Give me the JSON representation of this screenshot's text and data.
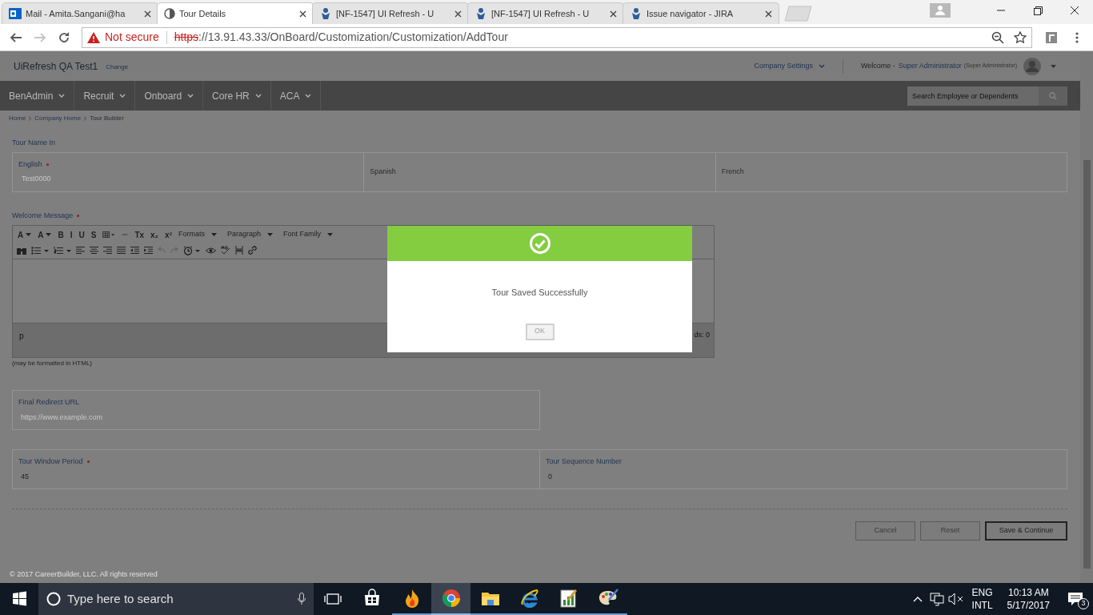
{
  "browser": {
    "tabs": [
      {
        "label": "Mail - Amita.Sangani@ha",
        "kind": "mail",
        "selected": false
      },
      {
        "label": "Tour Details",
        "kind": "page",
        "selected": true
      },
      {
        "label": "[NF-1547] UI Refresh - U",
        "kind": "jira",
        "selected": false
      },
      {
        "label": "[NF-1547] UI Refresh - U",
        "kind": "jira",
        "selected": false
      },
      {
        "label": "Issue navigator - JIRA",
        "kind": "jira",
        "selected": false
      }
    ],
    "security": "Not secure",
    "scheme": "https",
    "url": "://13.91.43.33/OnBoard/Customization/Customization/AddTour"
  },
  "header": {
    "title": "UiRefresh QA Test1",
    "change_link": "Change",
    "company_settings": "Company Settings",
    "welcome": "Welcome -",
    "user": "Super Administrator",
    "role": "(Super Administrator)"
  },
  "nav": {
    "items": [
      "BenAdmin",
      "Recruit",
      "Onboard",
      "Core HR",
      "ACA"
    ],
    "search_placeholder": "Search Employee or Dependents"
  },
  "breadcrumb": [
    "Home",
    "Company Home",
    "Tour Builder"
  ],
  "tour_name": {
    "label": "Tour Name In",
    "fields": [
      {
        "label": "English",
        "required": true,
        "placeholder": "Test0000"
      },
      {
        "label": "Spanish",
        "required": false
      },
      {
        "label": "French",
        "required": false
      }
    ]
  },
  "welcome_message": {
    "label": "Welcome Message",
    "required": true,
    "toolbar_row_1": [
      {
        "kind": "text",
        "text": "A"
      },
      {
        "kind": "text",
        "text": "A"
      },
      {
        "kind": "text",
        "text": "B"
      },
      {
        "kind": "text",
        "text": "I"
      },
      {
        "kind": "text",
        "text": "U"
      },
      {
        "kind": "text",
        "text": "S"
      },
      {
        "kind": "icon"
      },
      {
        "kind": "icon"
      },
      {
        "kind": "text",
        "text": "Tx"
      },
      {
        "kind": "text",
        "text": "x₂"
      },
      {
        "kind": "text",
        "text": "x²"
      },
      {
        "kind": "menu",
        "text": "Formats"
      },
      {
        "kind": "menu",
        "text": "Paragraph"
      },
      {
        "kind": "menu",
        "text": "Font Family"
      }
    ],
    "status_path": "p",
    "word_count": "ds: 0",
    "hint": "(may be formatted in HTML)"
  },
  "redirect": {
    "label": "Final Redirect URL",
    "placeholder": "https://www.example.com"
  },
  "window_period": {
    "label": "Tour Window Period",
    "required": true,
    "value": "45"
  },
  "sequence": {
    "label": "Tour Sequence Number",
    "required": false,
    "value": "0"
  },
  "buttons": [
    {
      "label": "Cancel",
      "kind": "default"
    },
    {
      "label": "Reset",
      "kind": "default"
    },
    {
      "label": "Save & Continue",
      "kind": "primary"
    }
  ],
  "footer": "© 2017 CareerBuilder, LLC. All rights reserved",
  "modal": {
    "message": "Tour Saved Successfully",
    "button": "OK"
  },
  "taskbar": {
    "search_placeholder": "Type here to search",
    "apps": [
      {
        "kind": "flame",
        "selected": false
      },
      {
        "kind": "chrome",
        "selected": true
      },
      {
        "kind": "folder",
        "selected": false
      },
      {
        "kind": "ie",
        "selected": false
      },
      {
        "kind": "chart",
        "selected": false
      },
      {
        "kind": "paint",
        "selected": false
      }
    ],
    "language": "ENG",
    "layout": "INTL",
    "time": "10:13 AM",
    "date": "5/17/2017",
    "notifications": "3"
  }
}
